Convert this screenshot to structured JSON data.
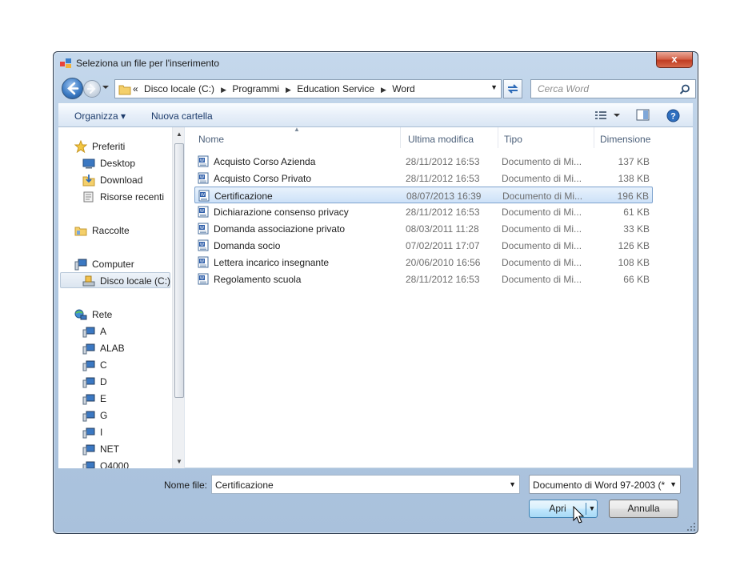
{
  "window": {
    "title": "Seleziona un file per l'inserimento",
    "close_label": "x"
  },
  "nav": {
    "crumb_prefix": "«",
    "breadcrumbs": [
      "Disco locale (C:)",
      "Programmi",
      "Education Service",
      "Word"
    ],
    "search_placeholder": "Cerca Word"
  },
  "toolbar": {
    "organize_label": "Organizza ▾",
    "new_folder_label": "Nuova cartella"
  },
  "sidebar": {
    "favorites": "Preferiti",
    "favorites_items": [
      "Desktop",
      "Download",
      "Risorse recenti"
    ],
    "libraries": "Raccolte",
    "computer": "Computer",
    "computer_items": [
      "Disco locale (C:)"
    ],
    "network": "Rete",
    "network_items": [
      "A",
      "ALAB",
      "C",
      "D",
      "E",
      "G",
      "I",
      "NET",
      "Q4000"
    ]
  },
  "file_list": {
    "columns": [
      "Nome",
      "Ultima modifica",
      "Tipo",
      "Dimensione"
    ],
    "rows": [
      {
        "name": "Acquisto Corso Azienda",
        "modified": "28/11/2012 16:53",
        "type": "Documento di Mi...",
        "size": "137 KB"
      },
      {
        "name": "Acquisto Corso Privato",
        "modified": "28/11/2012 16:53",
        "type": "Documento di Mi...",
        "size": "138 KB"
      },
      {
        "name": "Certificazione",
        "modified": "08/07/2013 16:39",
        "type": "Documento di Mi...",
        "size": "196 KB",
        "selected": true
      },
      {
        "name": "Dichiarazione consenso privacy",
        "modified": "28/11/2012 16:53",
        "type": "Documento di Mi...",
        "size": "61 KB"
      },
      {
        "name": "Domanda associazione privato",
        "modified": "08/03/2011 11:28",
        "type": "Documento di Mi...",
        "size": "33 KB"
      },
      {
        "name": "Domanda socio",
        "modified": "07/02/2011 17:07",
        "type": "Documento di Mi...",
        "size": "126 KB"
      },
      {
        "name": "Lettera incarico insegnante",
        "modified": "20/06/2010 16:56",
        "type": "Documento di Mi...",
        "size": "108 KB"
      },
      {
        "name": "Regolamento scuola",
        "modified": "28/11/2012 16:53",
        "type": "Documento di Mi...",
        "size": "66 KB"
      }
    ]
  },
  "footer": {
    "filename_label": "Nome file:",
    "filename_value": "Certificazione",
    "filetype_value": "Documento di Word 97-2003 (*",
    "open_label": "Apri",
    "cancel_label": "Annulla"
  }
}
